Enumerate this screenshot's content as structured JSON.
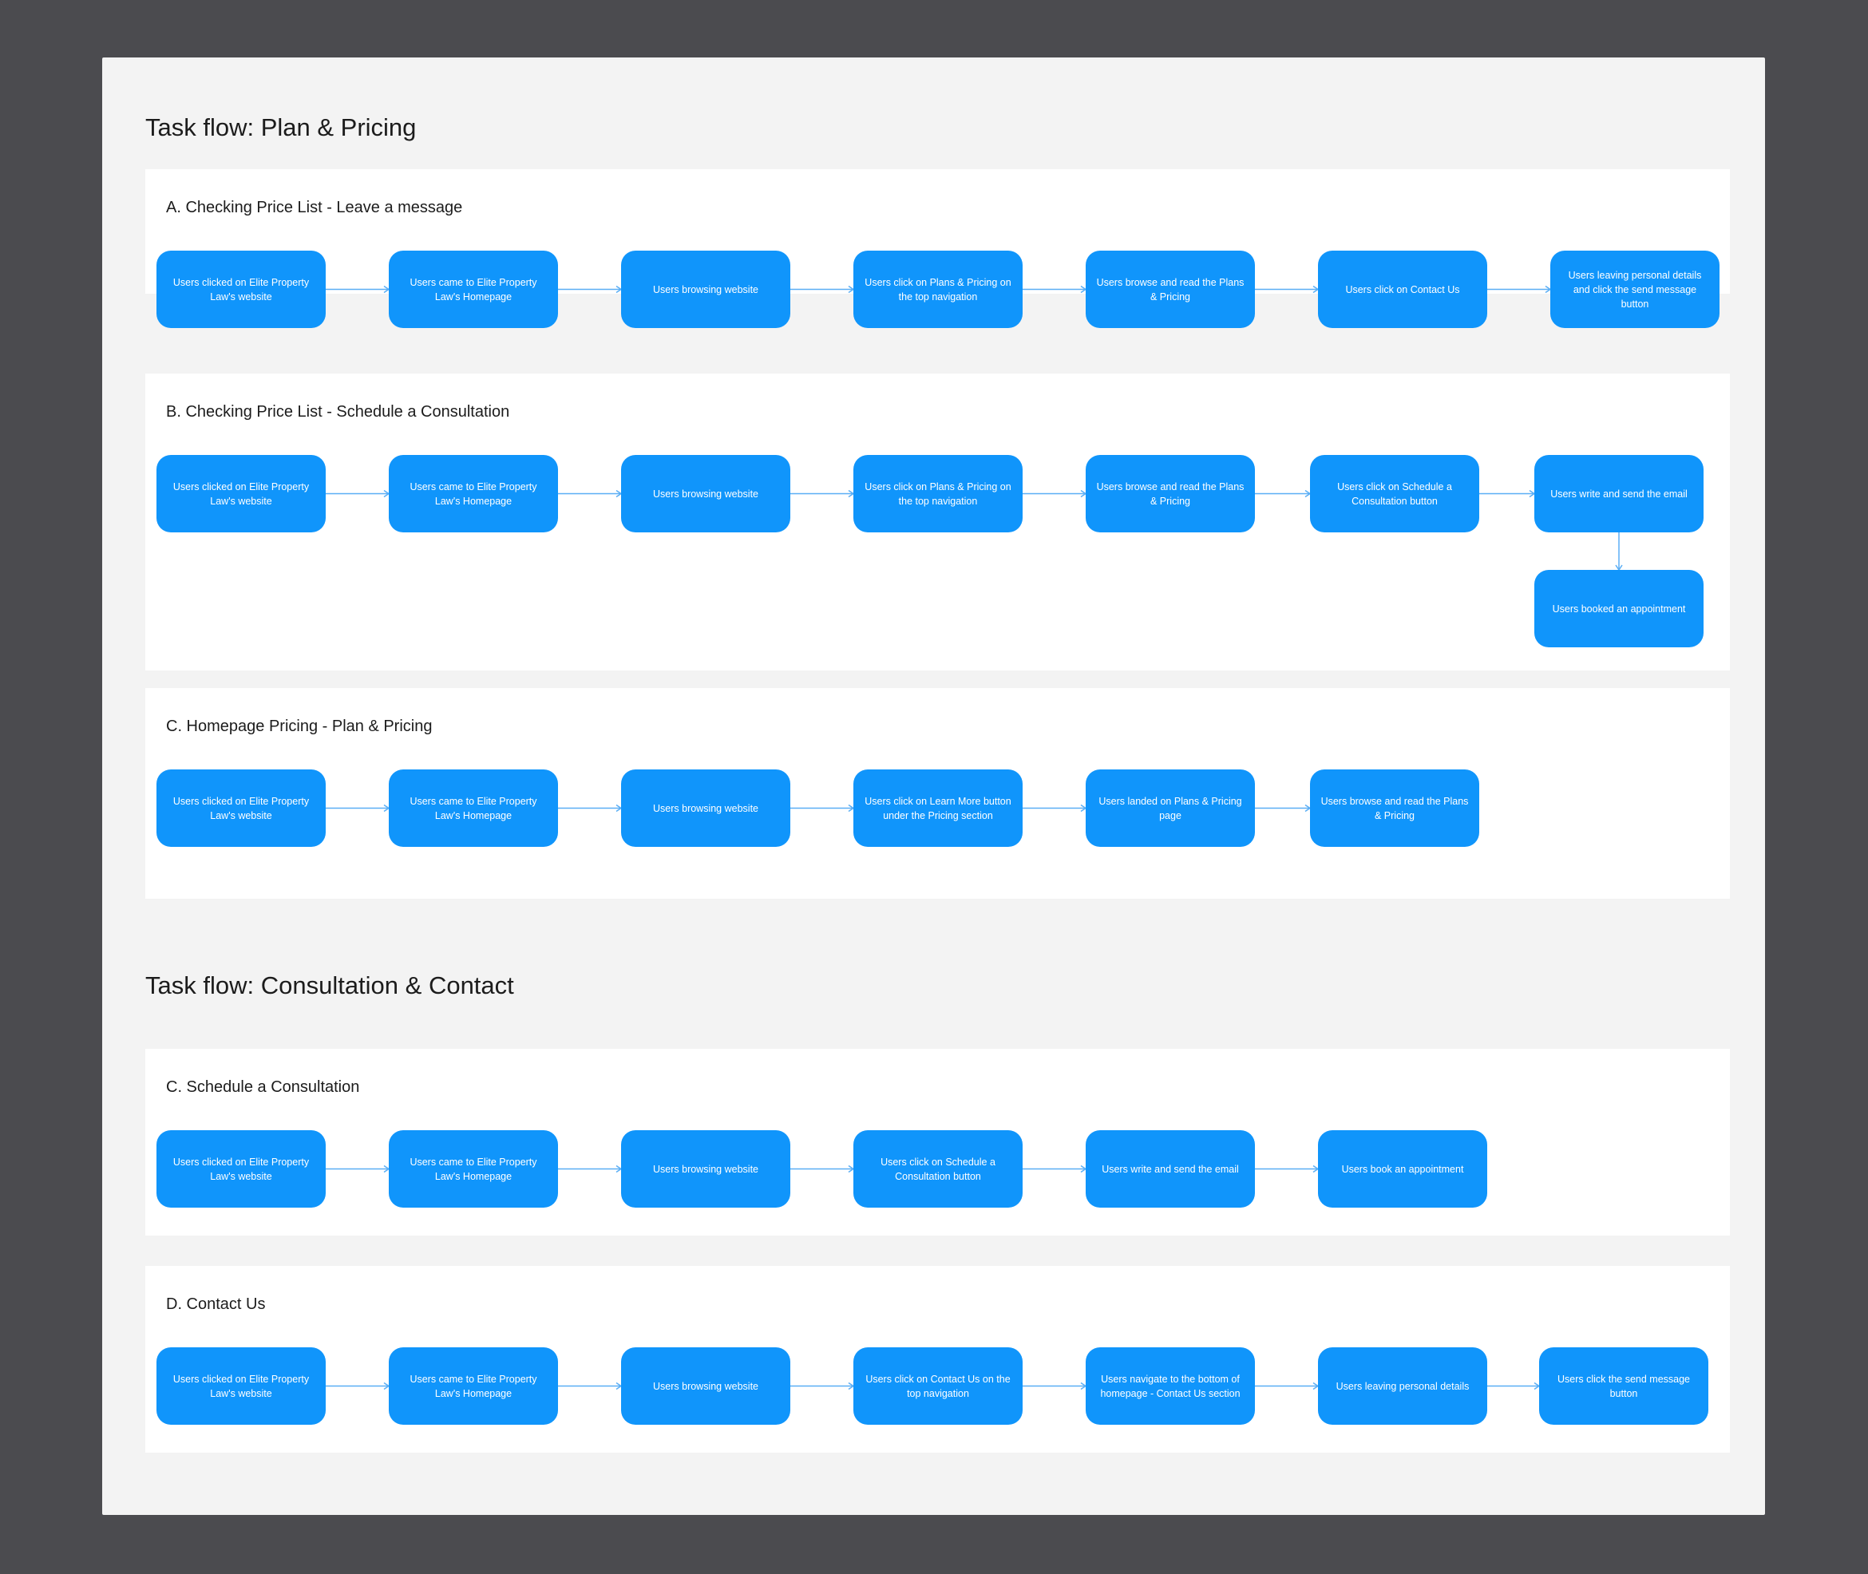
{
  "sections": [
    {
      "heading": "Task flow: Plan & Pricing",
      "flows": [
        {
          "title": "A. Checking Price List - Leave a message",
          "steps": [
            "Users clicked on Elite Property Law's website",
            "Users came to Elite Property Law's Homepage",
            "Users browsing website",
            "Users click on Plans & Pricing on the top navigation",
            "Users browse and read the Plans & Pricing",
            "Users click on Contact Us",
            "Users leaving personal details and click the send message button"
          ]
        },
        {
          "title": "B. Checking Price List - Schedule a Consultation",
          "steps": [
            "Users clicked on Elite Property Law's website",
            "Users came to Elite Property Law's Homepage",
            "Users browsing website",
            "Users click on Plans & Pricing on the top navigation",
            "Users browse and read the Plans & Pricing",
            "Users click on Schedule a Consultation button",
            "Users write and send the email",
            "Users booked an appointment"
          ]
        },
        {
          "title": "C. Homepage Pricing - Plan & Pricing",
          "steps": [
            "Users clicked on Elite Property Law's website",
            "Users came to Elite Property Law's Homepage",
            "Users browsing website",
            "Users click on Learn More button under the Pricing section",
            "Users landed on Plans & Pricing page",
            "Users browse and read the Plans & Pricing"
          ]
        }
      ]
    },
    {
      "heading": "Task flow: Consultation & Contact",
      "flows": [
        {
          "title": "C. Schedule a Consultation",
          "steps": [
            "Users clicked on Elite Property Law's website",
            "Users came to Elite Property Law's Homepage",
            "Users browsing website",
            "Users click on Schedule a Consultation button",
            "Users write and send the email",
            "Users book an appointment"
          ]
        },
        {
          "title": "D. Contact Us",
          "steps": [
            "Users clicked on Elite Property Law's website",
            "Users came to Elite Property Law's Homepage",
            "Users browsing website",
            "Users click on Contact Us on the top navigation",
            "Users navigate to the bottom of homepage - Contact Us section",
            "Users leaving personal details",
            "Users click the send message button"
          ]
        }
      ]
    }
  ],
  "colors": {
    "node": "#1095fb",
    "connector": "#5aaef5",
    "board": "#f3f3f3",
    "backdrop": "#4b4b4f"
  }
}
